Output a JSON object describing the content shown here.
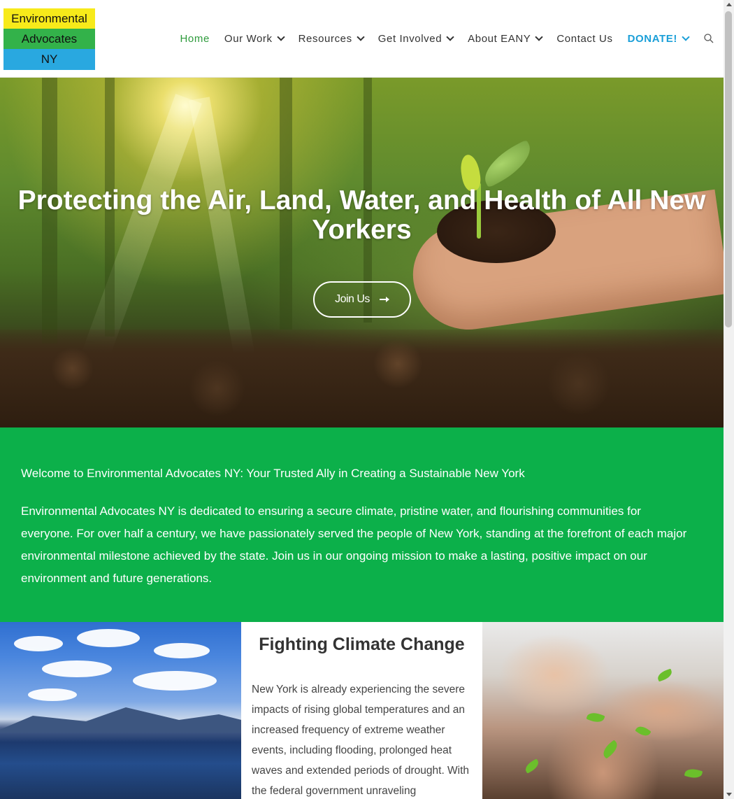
{
  "logo": {
    "line1": "Environmental",
    "line2": "Advocates",
    "line3": "NY"
  },
  "nav": {
    "items": [
      {
        "label": "Home",
        "has_dropdown": false
      },
      {
        "label": "Our Work",
        "has_dropdown": true
      },
      {
        "label": "Resources",
        "has_dropdown": true
      },
      {
        "label": "Get Involved",
        "has_dropdown": true
      },
      {
        "label": "About EANY",
        "has_dropdown": true
      },
      {
        "label": "Contact Us",
        "has_dropdown": false
      },
      {
        "label": "DONATE!",
        "has_dropdown": true
      }
    ],
    "search_icon": "search-icon"
  },
  "hero": {
    "title": "Protecting the Air, Land, Water, and Health of All New Yorkers",
    "button_label": "Join Us",
    "button_icon": "arrow-right-icon"
  },
  "welcome": {
    "heading": "Welcome to Environmental Advocates NY: Your Trusted Ally in Creating a Sustainable New York",
    "body": "Environmental Advocates NY is dedicated to ensuring a secure climate, pristine water, and flourishing communities for everyone. For over half a century, we have passionately served the people of New York, standing at the forefront of each major environmental milestone achieved by the state. Join us in our ongoing mission to make a lasting, positive impact on our environment and future generations."
  },
  "climate": {
    "title": "Fighting Climate Change",
    "body": "New York is already experiencing the severe impacts of rising global temperatures and an increased frequency of extreme weather events, including flooding, prolonged heat waves and extended periods of drought. With the federal government unraveling"
  },
  "colors": {
    "green_band": "#0cb04a",
    "donate": "#1a9fd8",
    "home_active": "#2e9b3c",
    "logo_yellow": "#f7ea1a",
    "logo_green": "#33b24a",
    "logo_blue": "#29a8e0"
  }
}
